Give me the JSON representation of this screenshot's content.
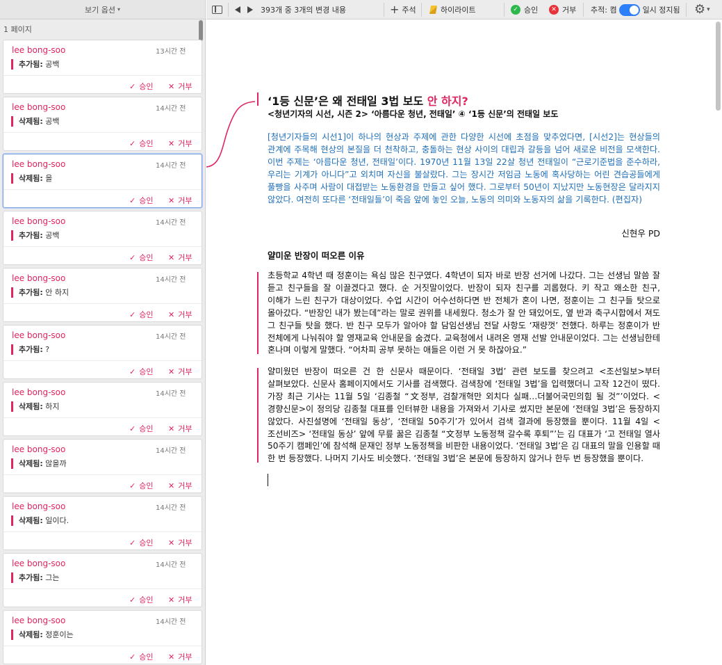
{
  "sidebar": {
    "view_options": "보기 옵션",
    "page_label": "1 페이지",
    "approve_label": "승인",
    "reject_label": "거부",
    "cards": [
      {
        "author": "lee bong-soo",
        "time": "13시간 전",
        "kind": "추가됨:",
        "text": "공백",
        "selected": false
      },
      {
        "author": "lee bong-soo",
        "time": "14시간 전",
        "kind": "삭제됨:",
        "text": "공백",
        "selected": false
      },
      {
        "author": "lee bong-soo",
        "time": "14시간 전",
        "kind": "삭제됨:",
        "text": "을",
        "selected": true
      },
      {
        "author": "lee bong-soo",
        "time": "14시간 전",
        "kind": "추가됨:",
        "text": "공백",
        "selected": false
      },
      {
        "author": "lee bong-soo",
        "time": "14시간 전",
        "kind": "추가됨:",
        "text": "안 하지",
        "selected": false
      },
      {
        "author": "lee bong-soo",
        "time": "14시간 전",
        "kind": "추가됨:",
        "text": "?",
        "selected": false
      },
      {
        "author": "lee bong-soo",
        "time": "14시간 전",
        "kind": "삭제됨:",
        "text": "하지",
        "selected": false
      },
      {
        "author": "lee bong-soo",
        "time": "14시간 전",
        "kind": "삭제됨:",
        "text": "않을까",
        "selected": false
      },
      {
        "author": "lee bong-soo",
        "time": "14시간 전",
        "kind": "삭제됨:",
        "text": "일이다.",
        "selected": false
      },
      {
        "author": "lee bong-soo",
        "time": "14시간 전",
        "kind": "추가됨:",
        "text": "그는",
        "selected": false
      },
      {
        "author": "lee bong-soo",
        "time": "14시간 전",
        "kind": "삭제됨:",
        "text": "정훈이는",
        "selected": false
      }
    ]
  },
  "toolbar": {
    "changes_label": "393개 중 3개의 변경 내용",
    "comment_label": "주석",
    "highlight_label": "하이라이트",
    "approve_label": "승인",
    "reject_label": "거부",
    "tracking_label": "추적: 켬",
    "pause_label": "일시 정지됨",
    "tracking_on": true
  },
  "colors": {
    "accent": "#e0245e",
    "link_blue": "#1f6fb7",
    "toggle": "#2d7ff9"
  },
  "doc": {
    "title_main": "‘1등 신문’은 왜 전태일 3법 보도 ",
    "title_ins": "안 하지?",
    "subtitle": "<청년기자의 시선, 시즌 2> ‘아름다운 청년, 전태일’ ④ ‘1등 신문’의 전태일 보도",
    "intro": "[청년기자들의 시선1]이 하나의 현상과 주제에 관한 다양한 시선에 초점을 맞추었다면, [시선2]는 현상들의 관계에 주목해 현상의 본질을 더 천착하고, 충돌하는 현상 사이의 대립과 갈등을 넘어 새로운 비전을 모색한다. 이번 주제는 ‘아름다운 청년, 전태일’이다. 1970년 11월 13일 22살 청년 전태일이 “근로기준법을 준수하라, 우리는 기계가 아니다”고 외치며 자신을 불살랐다. 그는 장시간 저임금 노동에 혹사당하는 어린 견습공들에게 풀빵을 사주며 사람이 대접받는 노동환경을 만들고 싶어 했다. 그로부터 50년이 지났지만 노동현장은 달라지지 않았다. 여전히 또다른 ‘전태일들’이 죽음 앞에 놓인 오늘, 노동의 의미와 노동자의 삶을 기록한다. (편집자)",
    "byline": "신현우 PD",
    "section_heading": "얄미운 반장이 떠오른 이유",
    "para1": "초등학교 4학년 때 정훈이는 욕심 많은 친구였다. 4학년이 되자 바로 반장 선거에 나갔다. 그는 선생님 말씀 잘 듣고 친구들을 잘 이끌겠다고 했다. 순 거짓말이었다. 반장이 되자 친구를 괴롭혔다. 키 작고 왜소한 친구, 이해가 느린 친구가 대상이었다. 수업 시간이 어수선하다면 반 전체가 혼이 나면, 정훈이는 그 친구들 탓으로 몰아갔다. “반장인 내가 봤는데”라는 말로 권위를 내세웠다. 청소가 잘 안 돼있어도, 옆 반과 축구시합에서 져도 그 친구들 탓을 했다. 반 친구 모두가 알아야 할 담임선생님 전달 사항도 ‘재량껏’ 전했다. 하루는 정훈이가 반 전체에게 나눠줘야 할 영재교육 안내문을 숨겼다. 교육청에서 내려온 영재 선발 안내문이었다. 그는 선생님한테 혼나며 이렇게 말했다. “어차피 공부 못하는 애들은 이런 거 못 하잖아요.”",
    "para2": "얄미웠던 반장이 떠오른 건 한 신문사 때문이다. ‘전태일 3법’ 관련 보도를 찾으려고 <조선일보>부터 살펴보았다. 신문사 홈페이지에서도 기사를 검색했다. 검색창에 ‘전태일 3법’을 입력했더니 고작 12건이 떴다. 가장 최근 기사는 11월 5일 ‘김종철 “文정부, 검찰개혁만 외치다 실패…더불어국민의힘 될 것”’이었다. <경향신문>이 정의당 김종철 대표를 인터뷰한 내용을 가져와서 기사로 썼지만 본문에 ‘전태일 3법’은 등장하지 않았다. 사진설명에 ‘전태일 동상’, ‘전태일 50주기’가 있어서 검색 결과에 등장했을 뿐이다. 11월 4일 <조선비즈> ‘전태일 동상’ 앞에 무릎 꿇은 김종철 “文정부 노동정책 갈수록 후퇴”’는 김 대표가 ‘고 전태일 열사 50주기 캠페인’에 참석해 문재인 정부 노동정책을 비판한 내용이었다. ‘전태일 3법’은 김 대표의 말을 인용할 때 한 번 등장했다. 나머지 기사도 비슷했다. ‘전태일 3법’은 본문에 등장하지 않거나 한두 번 등장했을 뿐이다."
  }
}
